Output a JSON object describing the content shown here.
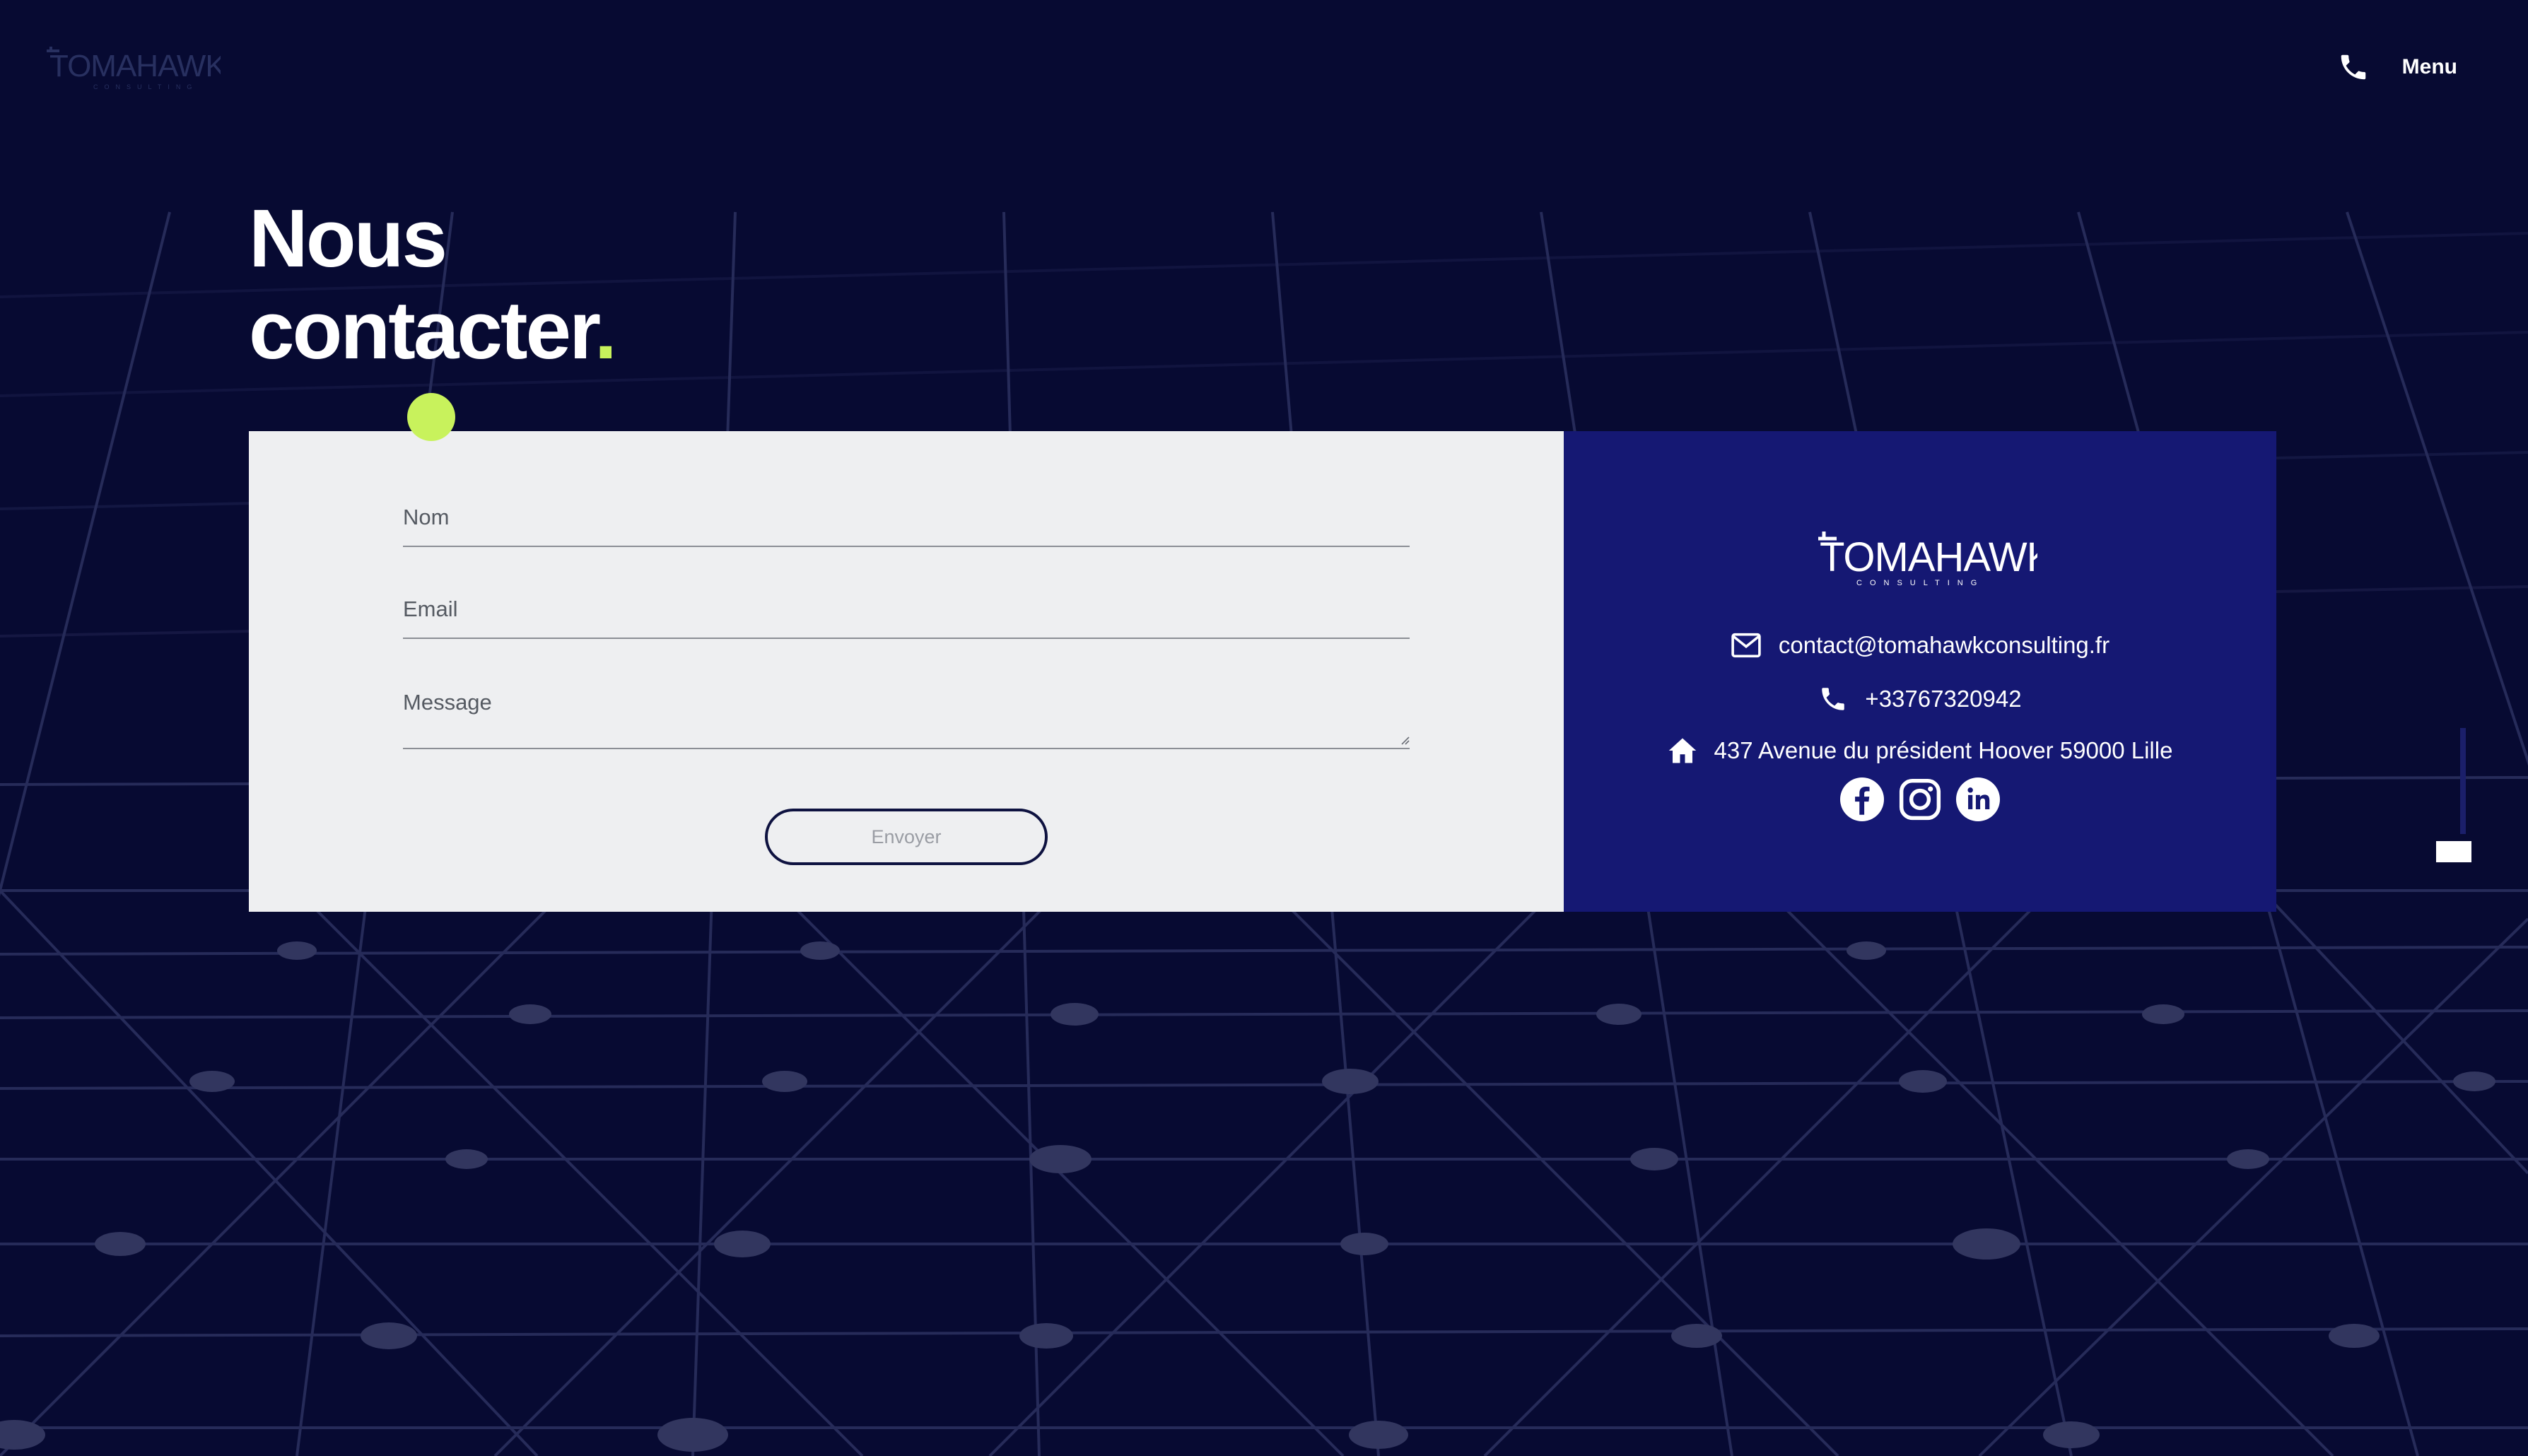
{
  "header": {
    "logo_text": "TOMAHAWK",
    "logo_subtext": "CONSULTING",
    "phone_icon": "phone-icon",
    "menu_label": "Menu"
  },
  "page": {
    "title_line1": "Nous",
    "title_line2": "contacter",
    "title_dot": "."
  },
  "form": {
    "name_label": "Nom",
    "email_label": "Email",
    "message_label": "Message",
    "submit_label": "Envoyer"
  },
  "contact": {
    "logo_text": "TOMAHAWK",
    "logo_subtext": "CONSULTING",
    "email": "contact@tomahawkconsulting.fr",
    "phone": "+33767320942",
    "address": "437 Avenue du président Hoover 59000 Lille",
    "social_icons": [
      "facebook-icon",
      "instagram-icon",
      "linkedin-icon"
    ]
  },
  "colors": {
    "background": "#070a32",
    "accent": "#c8f25c",
    "info_panel": "#151873",
    "form_panel": "#eeeff1"
  }
}
